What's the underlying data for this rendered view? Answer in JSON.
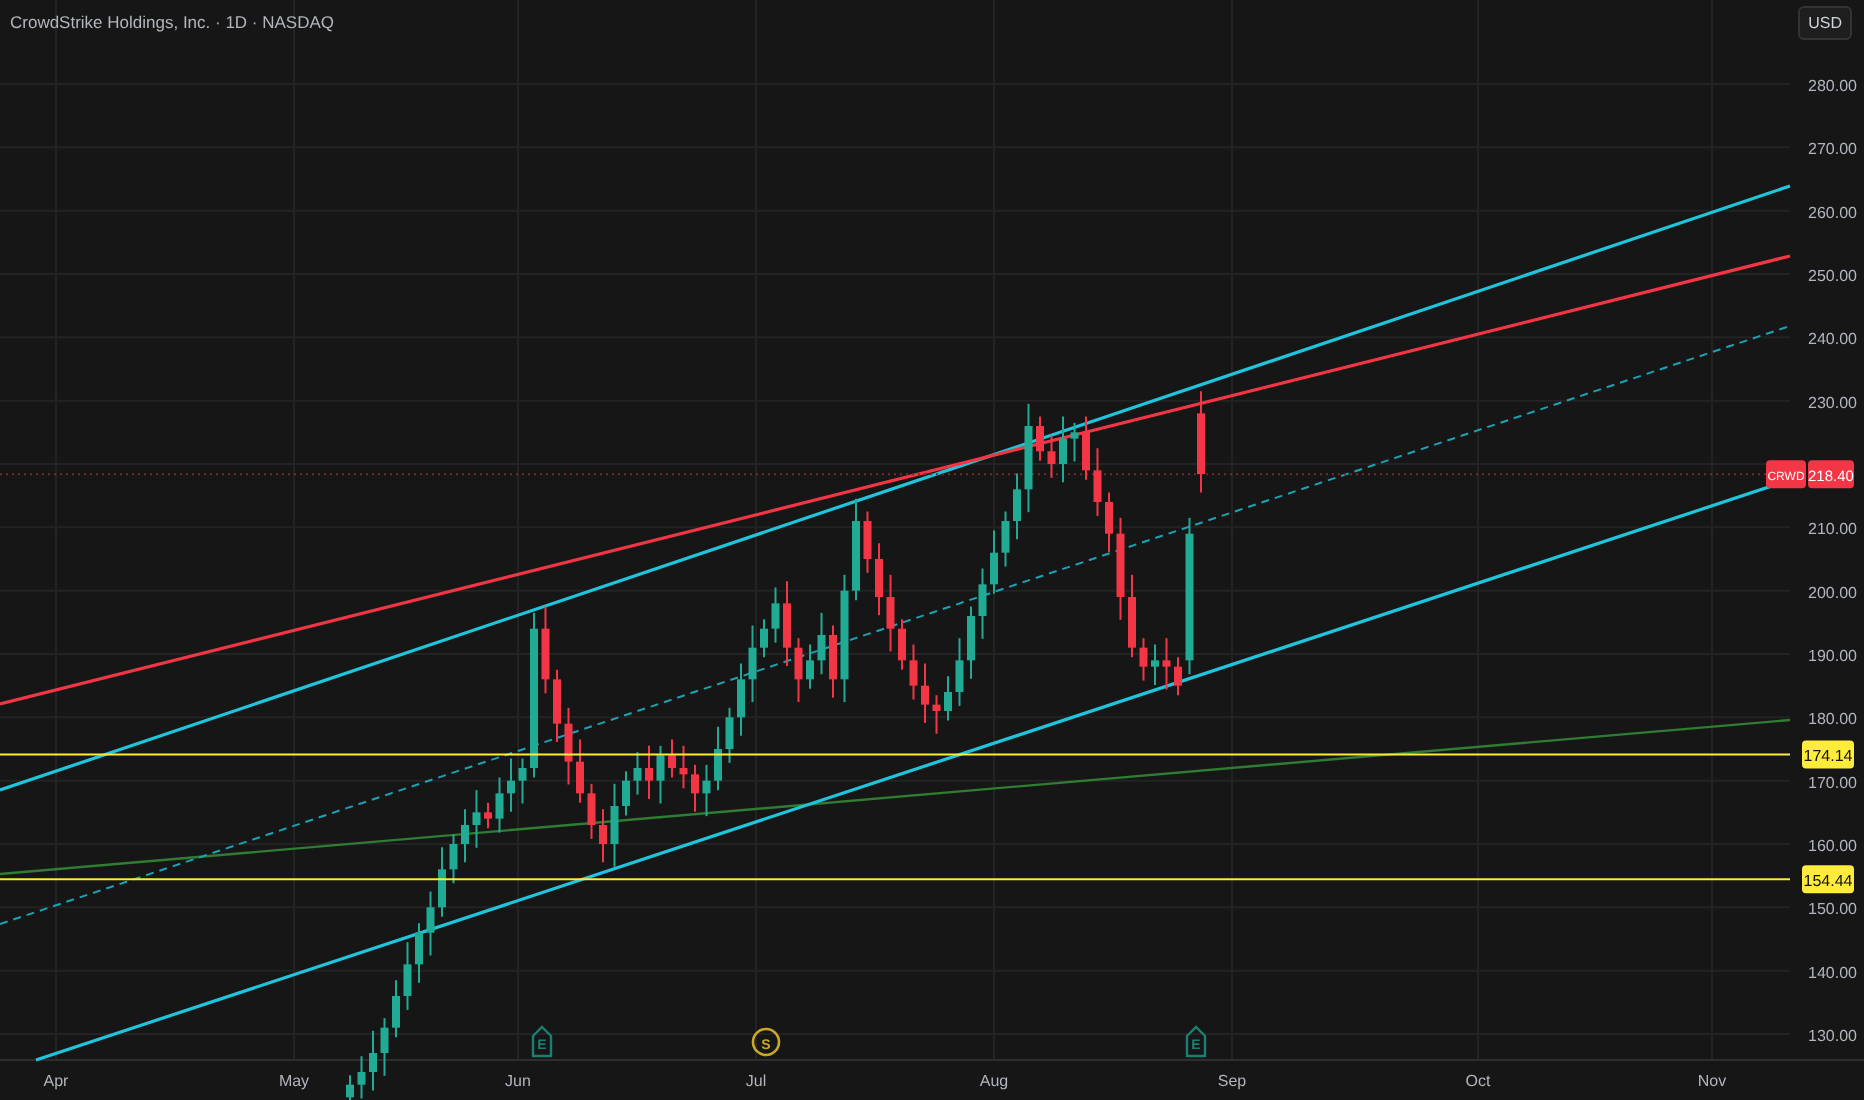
{
  "title": "CrowdStrike Holdings, Inc. · 1D · NASDAQ",
  "currency_button": "USD",
  "price_axis": [
    "280.00",
    "270.00",
    "260.00",
    "250.00",
    "240.00",
    "230.00",
    "210.00",
    "200.00",
    "190.00",
    "180.00",
    "170.00",
    "160.00",
    "150.00",
    "140.00",
    "130.00"
  ],
  "last_price": {
    "symbol": "CRWD",
    "price": "218.40"
  },
  "level_tags": [
    {
      "label": "174.14",
      "color": "#ffeb3b"
    },
    {
      "label": "154.44",
      "color": "#ffeb3b"
    }
  ],
  "time_axis": [
    "Apr",
    "May",
    "Jun",
    "Jul",
    "Aug",
    "Sep",
    "Oct",
    "Nov"
  ],
  "events": [
    {
      "kind": "earnings",
      "letter": "E"
    },
    {
      "kind": "split",
      "letter": "S"
    },
    {
      "kind": "earnings",
      "letter": "E"
    }
  ]
}
